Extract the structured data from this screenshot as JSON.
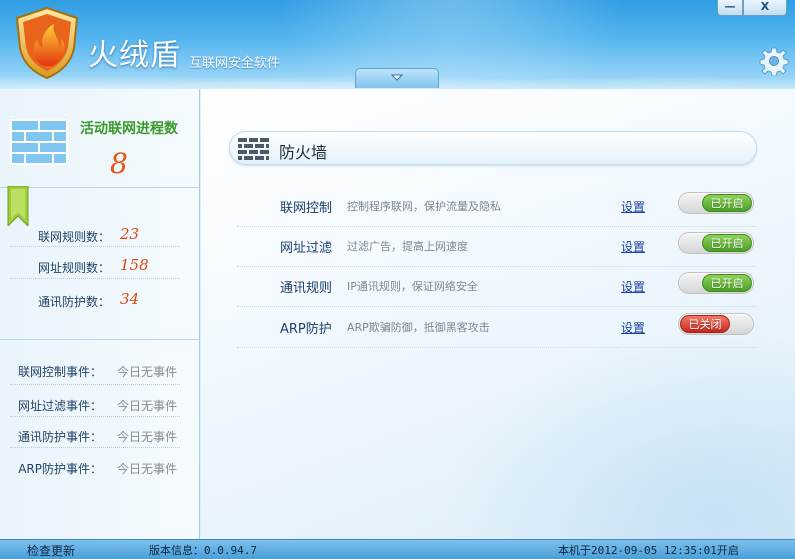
{
  "header": {
    "brand": "火绒盾",
    "subtitle": "互联网安全软件",
    "minimize_label": "—",
    "close_label": "X"
  },
  "sidebar": {
    "process_title": "活动联网进程数",
    "process_count": "8",
    "stats": [
      {
        "label": "联网规则数：",
        "value": "23"
      },
      {
        "label": "网址规则数：",
        "value": "158"
      },
      {
        "label": "通讯防护数：",
        "value": "34"
      }
    ],
    "events": [
      {
        "label": "联网控制事件：",
        "value": "今日无事件"
      },
      {
        "label": "网址过滤事件：",
        "value": "今日无事件"
      },
      {
        "label": "通讯防护事件：",
        "value": "今日无事件"
      },
      {
        "label": "ARP防护事件：",
        "value": "今日无事件"
      }
    ]
  },
  "main": {
    "section_title": "防火墙",
    "features": [
      {
        "name": "联网控制",
        "desc": "控制程序联网，保护流量及隐私",
        "settings": "设置",
        "state": "已开启",
        "on": true
      },
      {
        "name": "网址过滤",
        "desc": "过滤广告，提高上网速度",
        "settings": "设置",
        "state": "已开启",
        "on": true
      },
      {
        "name": "通讯规则",
        "desc": "IP通讯规则，保证网络安全",
        "settings": "设置",
        "state": "已开启",
        "on": true
      },
      {
        "name": "ARP防护",
        "desc": "ARP欺骗防御，抵御黑客攻击",
        "settings": "设置",
        "state": "已关闭",
        "on": false
      }
    ]
  },
  "statusbar": {
    "update": "检查更新",
    "version": "版本信息：0.0.94.7",
    "boot": "本机于2012-09-05  12:35:01开启"
  },
  "colors": {
    "accent_green": "#3a9a2c",
    "count_orange": "#e2580f",
    "toggle_on": "#4ba126",
    "toggle_off": "#c8281c",
    "header_blue": "#2f9de4"
  },
  "icons": [
    "shield-flame-icon",
    "gear-icon",
    "chevron-down-icon",
    "brick-wall-icon",
    "bookmark-icon",
    "firewall-icon"
  ]
}
